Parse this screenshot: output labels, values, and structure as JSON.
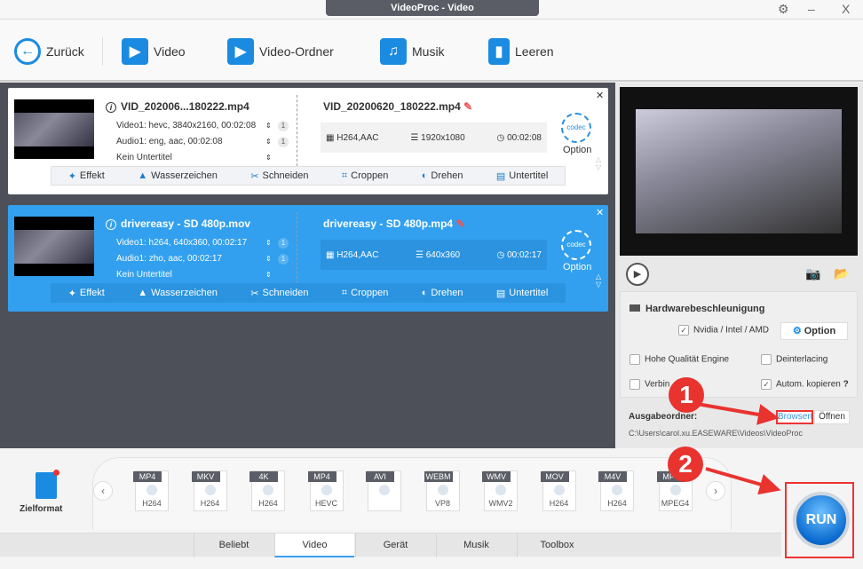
{
  "window": {
    "title": "VideoProc - Video",
    "gear": "⚙",
    "minimize": "–",
    "close": "X"
  },
  "toolbar": {
    "back": "Zurück",
    "video": "Video",
    "folder": "Video-Ordner",
    "music": "Musik",
    "clear": "Leeren"
  },
  "files": [
    {
      "src_name": "VID_202006...180222.mp4",
      "video": "Video1: hevc, 3840x2160, 00:02:08",
      "audio": "Audio1: eng, aac, 00:02:08",
      "subtitle": "Kein Untertitel",
      "video_count": "1",
      "audio_count": "1",
      "dst_name": "VID_20200620_180222.mp4",
      "codec": "H264,AAC",
      "resolution": "1920x1080",
      "duration": "00:02:08",
      "selected": false
    },
    {
      "src_name": "drivereasy - SD 480p.mov",
      "video": "Video1: h264, 640x360, 00:02:17",
      "audio": "Audio1: zho, aac, 00:02:17",
      "subtitle": "Kein Untertitel",
      "video_count": "1",
      "audio_count": "1",
      "dst_name": "drivereasy - SD 480p.mp4",
      "codec": "H264,AAC",
      "resolution": "640x360",
      "duration": "00:02:17",
      "selected": true
    }
  ],
  "card": {
    "codec_label": "codec",
    "option": "Option",
    "actions": [
      "Effekt",
      "Wasserzeichen",
      "Schneiden",
      "Croppen",
      "Drehen",
      "Untertitel"
    ]
  },
  "settings": {
    "hw_title": "Hardwarebeschleunigung",
    "hw_vendor": "Nvidia / Intel / AMD",
    "hw_checked": true,
    "option": "Option",
    "high_quality": "Hohe Qualität Engine",
    "deinterlacing": "Deinterlacing",
    "merge": "Verbin",
    "auto_copy": "Autom. kopieren",
    "auto_copy_help": "?",
    "output_label": "Ausgabeordner:",
    "browse": "Browsen",
    "open": "Öffnen",
    "path": "C:\\Users\\carol.xu.EASEWARE\\Videos\\VideoProc"
  },
  "bottom": {
    "target_format": "Zielformat",
    "formats": [
      [
        "MP4",
        "H264"
      ],
      [
        "MKV",
        "H264"
      ],
      [
        "4K",
        "H264"
      ],
      [
        "MP4",
        "HEVC"
      ],
      [
        "AVI",
        ""
      ],
      [
        "WEBM",
        "VP8"
      ],
      [
        "WMV",
        "WMV2"
      ],
      [
        "MOV",
        "H264"
      ],
      [
        "M4V",
        "H264"
      ],
      [
        "MP4",
        "MPEG4"
      ]
    ],
    "tabs": [
      "Beliebt",
      "Video",
      "Gerät",
      "Musik",
      "Toolbox"
    ],
    "active_tab": "Video",
    "run": "RUN"
  },
  "annotations": {
    "step1": "1",
    "step2": "2",
    "color": "#e8332f"
  }
}
